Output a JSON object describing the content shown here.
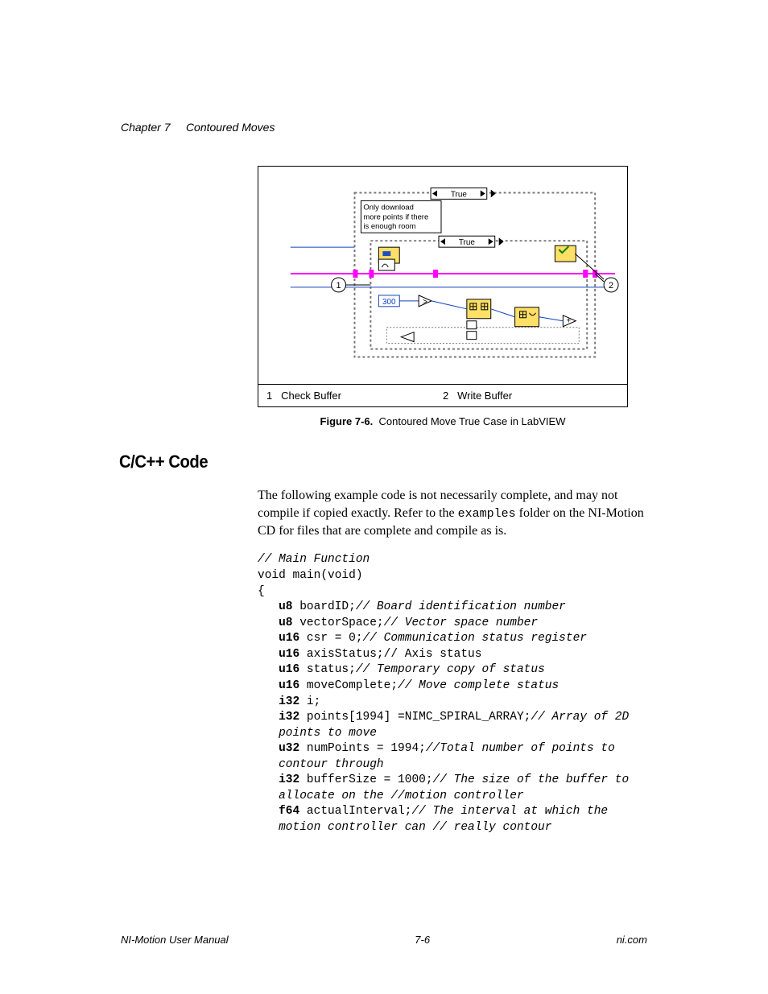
{
  "header": {
    "chapter": "Chapter 7",
    "title": "Contoured Moves"
  },
  "figure": {
    "number": "Figure 7-6.",
    "caption": "Contoured Move True Case in LabVIEW",
    "callouts": {
      "left_num": "1",
      "right_num": "2"
    },
    "diagram": {
      "outer_true": "True",
      "inner_true": "True",
      "note_l1": "Only download",
      "note_l2": "more points if there",
      "note_l3": "is enough room",
      "wait_ms": "300"
    },
    "legend": {
      "item1_num": "1",
      "item1_label": "Check Buffer",
      "item2_num": "2",
      "item2_label": "Write Buffer"
    }
  },
  "section_heading": "C/C++ Code",
  "para": {
    "p1a": "The following example code is not necessarily complete, and may not compile if copied exactly. Refer to the ",
    "p1b": "examples",
    "p1c": " folder on the NI-Motion CD for files that are complete and compile as is."
  },
  "code": {
    "l01_cm": "// Main Function",
    "l02": "void main(void)",
    "l03": "{",
    "l04_kw": "u8",
    "l04_rest": " boardID;",
    "l04_cm": "// Board identification number",
    "l05_kw": "u8",
    "l05_rest": " vectorSpace;",
    "l05_cm": "// Vector space number",
    "l06_kw": "u16",
    "l06_rest": " csr = 0;",
    "l06_cm": "// Communication status register",
    "l07_kw": "u16",
    "l07_rest": " axisStatus;// Axis status",
    "l08_kw": "u16",
    "l08_rest": " status;",
    "l08_cm": "// Temporary copy of status",
    "l09_kw": "u16",
    "l09_rest": " moveComplete;",
    "l09_cm": "// Move complete status",
    "l10_kw": "i32",
    "l10_rest": " i;",
    "l11_kw": "i32",
    "l11_rest": " points[1994] =NIMC_SPIRAL_ARRAY;",
    "l11_cm": "// Array of 2D",
    "l12_cm": "points to move",
    "l13_kw": "u32",
    "l13_rest": " numPoints = 1994;",
    "l13_cm": "//Total number of points to",
    "l14_cm": "contour through",
    "l15_kw": "i32",
    "l15_rest": " bufferSize = 1000;",
    "l15_cm": "// The size of the buffer to",
    "l16_cm": "allocate on the //motion controller",
    "l17_kw": "f64",
    "l17_rest": " actualInterval;",
    "l17_cm": "// The interval at which the",
    "l18_cm": "motion controller can // really contour"
  },
  "footer": {
    "left": "NI-Motion User Manual",
    "center": "7-6",
    "right": "ni.com"
  }
}
